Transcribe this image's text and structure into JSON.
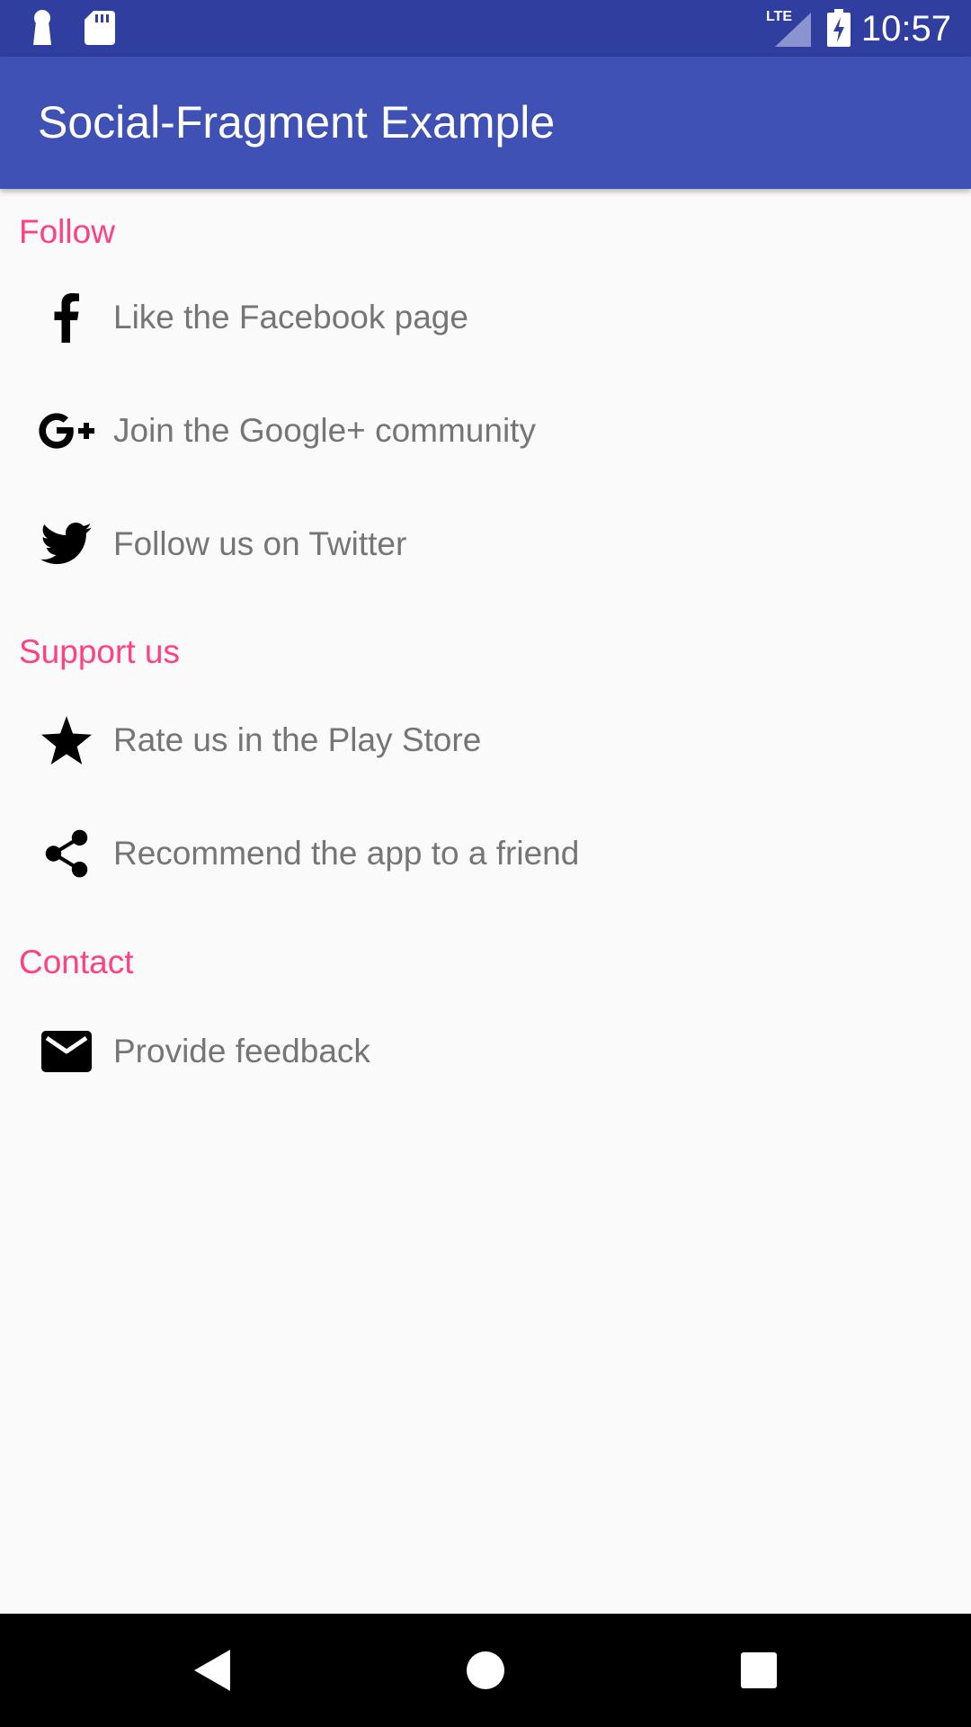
{
  "status_bar": {
    "time": "10:57",
    "network": "LTE",
    "icons": [
      "keyhole-icon",
      "sd-card-icon",
      "lte-signal-icon",
      "battery-charging-icon"
    ]
  },
  "app_bar": {
    "title": "Social-Fragment Example",
    "color": "#3f51b5"
  },
  "sections": [
    {
      "header": "Follow",
      "items": [
        {
          "label": "Like the Facebook page",
          "icon": "facebook-icon"
        },
        {
          "label": "Join the Google+ community",
          "icon": "google-plus-icon"
        },
        {
          "label": "Follow us on Twitter",
          "icon": "twitter-icon"
        }
      ]
    },
    {
      "header": "Support us",
      "items": [
        {
          "label": "Rate us in the Play Store",
          "icon": "star-icon"
        },
        {
          "label": "Recommend the app to a friend",
          "icon": "share-icon"
        }
      ]
    },
    {
      "header": "Contact",
      "items": [
        {
          "label": "Provide feedback",
          "icon": "mail-icon"
        }
      ]
    }
  ],
  "colors": {
    "accent": "#ff4081",
    "primary_dark": "#303f9f",
    "item_text": "#757575"
  },
  "nav_bar": {
    "buttons": [
      "back-icon",
      "home-icon",
      "recents-icon"
    ]
  }
}
